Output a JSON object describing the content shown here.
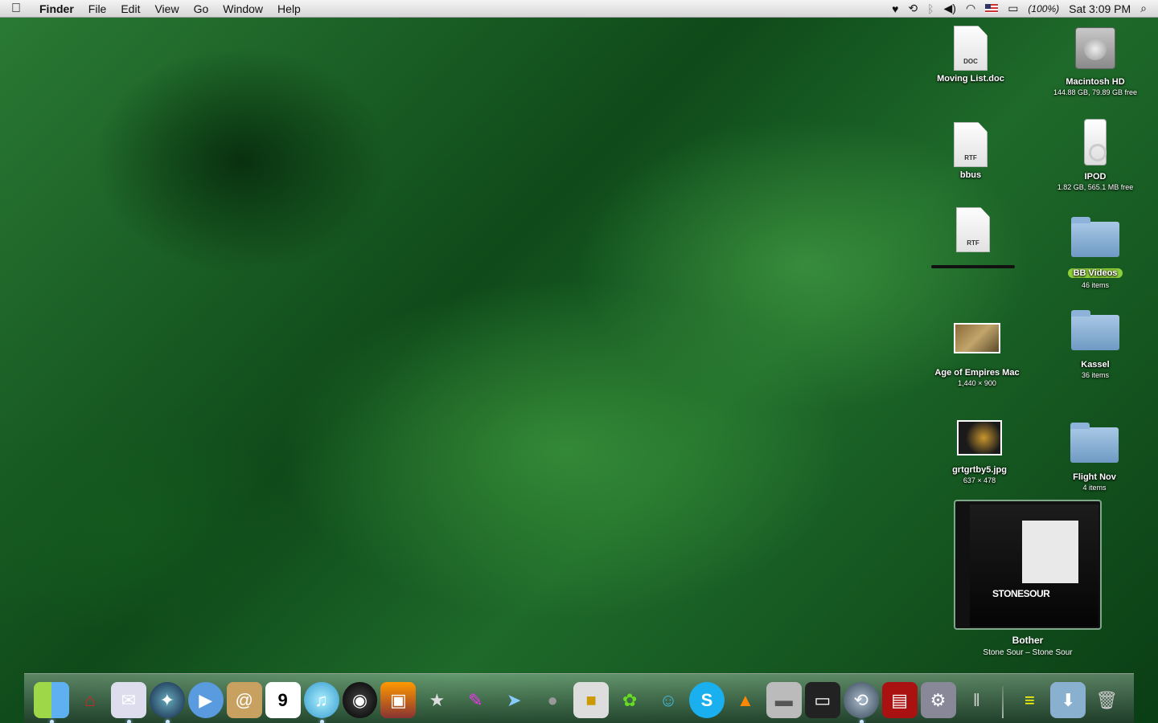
{
  "menubar": {
    "app_name": "Finder",
    "menus": [
      "File",
      "Edit",
      "View",
      "Go",
      "Window",
      "Help"
    ],
    "battery": "(100%)",
    "clock": "Sat 3:09 PM"
  },
  "desktop": {
    "moving_list": {
      "name": "Moving List.doc",
      "ext": "DOC"
    },
    "macintosh_hd": {
      "name": "Macintosh HD",
      "info": "144.88 GB, 79.89 GB free"
    },
    "bbus": {
      "name": "bbus",
      "ext": "RTF"
    },
    "ipod": {
      "name": "IPOD",
      "info": "1.82 GB, 565.1 MB free"
    },
    "rtf_unnamed": {
      "ext": "RTF"
    },
    "bb_videos": {
      "name": "BB Videos",
      "info": "46 items"
    },
    "age_of_empires": {
      "name": "Age of Empires Mac",
      "info": "1,440 × 900"
    },
    "kassel": {
      "name": "Kassel",
      "info": "36 items"
    },
    "grtgrtby5": {
      "name": "grtgrtby5.jpg",
      "info": "637 × 478"
    },
    "flight_nov": {
      "name": "Flight Nov",
      "info": "4 items"
    }
  },
  "album": {
    "band_text": "STONESOUR",
    "track": "Bother",
    "artist_album": "Stone Sour – Stone Sour"
  },
  "colors": {
    "label_green": "#8fd03a",
    "wallpaper": "#1e6a2a"
  }
}
